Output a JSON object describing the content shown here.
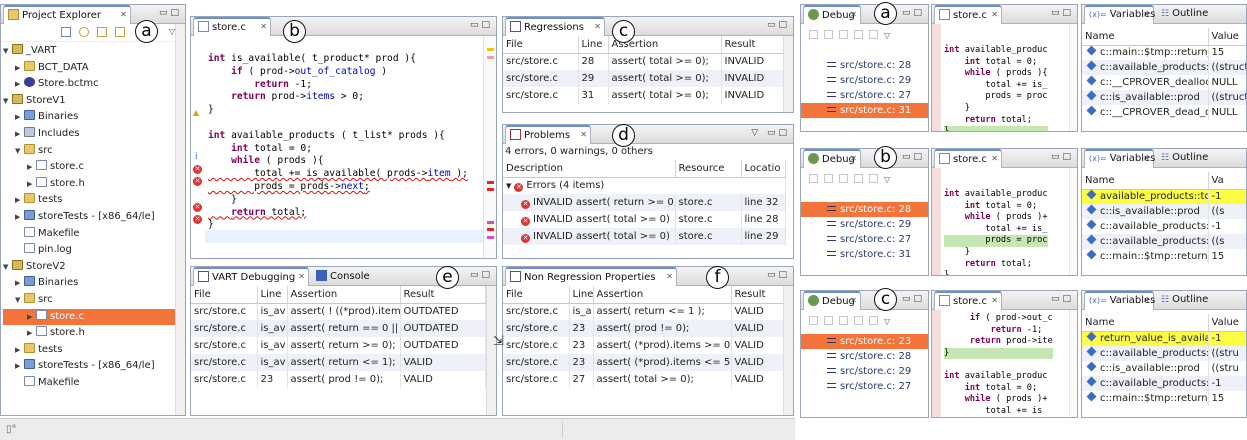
{
  "project_explorer": {
    "title": "Project Explorer",
    "items": [
      {
        "label": "_VART",
        "depth": 0,
        "kind": "proj",
        "expanded": true
      },
      {
        "label": "BCT_DATA",
        "depth": 1,
        "kind": "folder"
      },
      {
        "label": "Store.bctmc",
        "depth": 1,
        "kind": "dot"
      },
      {
        "label": "StoreV1",
        "depth": 0,
        "kind": "proj",
        "expanded": true
      },
      {
        "label": "Binaries",
        "depth": 1,
        "kind": "bin"
      },
      {
        "label": "Includes",
        "depth": 1,
        "kind": "inc"
      },
      {
        "label": "src",
        "depth": 1,
        "kind": "folder",
        "expanded": true
      },
      {
        "label": "store.c",
        "depth": 2,
        "kind": "file"
      },
      {
        "label": "store.h",
        "depth": 2,
        "kind": "file"
      },
      {
        "label": "tests",
        "depth": 1,
        "kind": "folder"
      },
      {
        "label": "storeTests - [x86_64/le]",
        "depth": 1,
        "kind": "bin"
      },
      {
        "label": "Makefile",
        "depth": 1,
        "kind": "file"
      },
      {
        "label": "pin.log",
        "depth": 1,
        "kind": "file"
      },
      {
        "label": "StoreV2",
        "depth": 0,
        "kind": "proj",
        "expanded": true
      },
      {
        "label": "Binaries",
        "depth": 1,
        "kind": "bin"
      },
      {
        "label": "src",
        "depth": 1,
        "kind": "folder",
        "expanded": true
      },
      {
        "label": "store.c",
        "depth": 2,
        "kind": "file",
        "selected": true
      },
      {
        "label": "store.h",
        "depth": 2,
        "kind": "file"
      },
      {
        "label": "tests",
        "depth": 1,
        "kind": "folder"
      },
      {
        "label": "storeTests - [x86_64/le]",
        "depth": 1,
        "kind": "bin"
      },
      {
        "label": "Makefile",
        "depth": 1,
        "kind": "file"
      }
    ]
  },
  "editor": {
    "title": "store.c",
    "lines": [
      "int is_available( t_product* prod ){",
      "    if ( prod->out_of_catalog )",
      "        return -1;",
      "    return prod->items > 0;",
      "}",
      "",
      "int available_products ( t_list* prods ){",
      "    int total = 0;",
      "    while ( prods ){",
      "        total += is_available( prods->item );",
      "        prods = prods->next;",
      "    }",
      "    return total;",
      "}"
    ]
  },
  "regressions": {
    "title": "Regressions",
    "columns": [
      "File",
      "Line",
      "Assertion",
      "Result"
    ],
    "rows": [
      [
        "src/store.c",
        "28",
        "assert( total >= 0);",
        "INVALID"
      ],
      [
        "src/store.c",
        "29",
        "assert( total >= 0);",
        "INVALID"
      ],
      [
        "src/store.c",
        "31",
        "assert( total >= 0);",
        "INVALID"
      ]
    ]
  },
  "problems": {
    "title": "Problems",
    "summary": "4 errors, 0 warnings, 0 others",
    "columns": [
      "Description",
      "Resource",
      "Locatio"
    ],
    "group": "Errors (4 items)",
    "rows": [
      [
        "INVALID assert( return >= 0)",
        "store.c",
        "line 32"
      ],
      [
        "INVALID assert( total >= 0)",
        "store.c",
        "line 28"
      ],
      [
        "INVALID assert( total >= 0)",
        "store.c",
        "line 29"
      ]
    ]
  },
  "vart": {
    "title": "VART Debugging",
    "console_tab": "Console",
    "columns": [
      "File",
      "Line",
      "Assertion",
      "Result"
    ],
    "rows": [
      [
        "src/store.c",
        "is_av",
        "assert( ! ((*prod).item",
        "OUTDATED"
      ],
      [
        "src/store.c",
        "is_av",
        "assert( return == 0 || re",
        "OUTDATED"
      ],
      [
        "src/store.c",
        "is_av",
        "assert( return >= 0);",
        "OUTDATED"
      ],
      [
        "src/store.c",
        "is_av",
        "assert( return <= 1);",
        "VALID"
      ],
      [
        "src/store.c",
        "23",
        "assert( prod != 0);",
        "VALID"
      ]
    ]
  },
  "nonreg": {
    "title": "Non Regression Properties",
    "columns": [
      "File",
      "Line",
      "Assertion",
      "Result"
    ],
    "rows": [
      [
        "src/store.c",
        "is_a",
        "assert( return <= 1 );",
        "VALID"
      ],
      [
        "src/store.c",
        "23",
        "assert( prod != 0);",
        "VALID"
      ],
      [
        "src/store.c",
        "23",
        "assert( (*prod).items >= 0);",
        "VALID"
      ],
      [
        "src/store.c",
        "23",
        "assert( (*prod).items <= 5);",
        "VALID"
      ],
      [
        "src/store.c",
        "27",
        "assert( total >= 0);",
        "VALID"
      ]
    ]
  },
  "callouts": {
    "a": "a",
    "b": "b",
    "c": "c",
    "d": "d",
    "e": "e",
    "f": "f"
  },
  "right_panels": [
    {
      "callout": "a",
      "debug_title": "Debug",
      "editor_title": "store.c",
      "vars_title": "Variables",
      "outline_title": "Outline",
      "var_columns": [
        "Name",
        "Value"
      ],
      "frames": [
        {
          "label": "src/store.c: 28",
          "selected": false
        },
        {
          "label": "src/store.c: 29",
          "selected": false
        },
        {
          "label": "src/store.c: 27",
          "selected": false
        },
        {
          "label": "src/store.c: 31",
          "selected": true
        }
      ],
      "code": [
        "int available_produc",
        "    int total = 0;",
        "    while ( prods ){",
        "        total += is_",
        "        prods = proc",
        "    }",
        "    return total;",
        "}"
      ],
      "vars": [
        {
          "name": "c::main::$tmp::return_",
          "value": "15",
          "hl": false
        },
        {
          "name": "c::available_products:",
          "value": "((struct li",
          "hl": false
        },
        {
          "name": "c::__CPROVER_dealloc",
          "value": "NULL",
          "hl": false
        },
        {
          "name": "c::is_available::prod",
          "value": "((struct p",
          "hl": false
        },
        {
          "name": "c::__CPROVER_dead_c",
          "value": "NULL",
          "hl": false
        }
      ]
    },
    {
      "callout": "b",
      "debug_title": "Debug",
      "editor_title": "store.c",
      "vars_title": "Variables",
      "outline_title": "Outline",
      "var_columns": [
        "Name",
        "Va"
      ],
      "frames": [
        {
          "label": "src/store.c: 28",
          "selected": true
        },
        {
          "label": "src/store.c: 29",
          "selected": false
        },
        {
          "label": "src/store.c: 27",
          "selected": false
        },
        {
          "label": "src/store.c: 31",
          "selected": false
        }
      ],
      "code": [
        "int available_produc",
        "    int total = 0;",
        "    while ( prods )+",
        "        total += is_",
        "        prods = proc",
        "    }",
        "    return total;",
        "}"
      ],
      "vars": [
        {
          "name": "available_products::total",
          "value": "-1",
          "hl": true
        },
        {
          "name": "c::is_available::prod",
          "value": "((s",
          "hl": false
        },
        {
          "name": "c::available_products::$tm",
          "value": "-1",
          "hl": false
        },
        {
          "name": "c::available_products::pro",
          "value": "((s",
          "hl": false
        },
        {
          "name": "c::main::$tmp::return_valu",
          "value": "15",
          "hl": false
        }
      ]
    },
    {
      "callout": "c",
      "debug_title": "Debug",
      "editor_title": "store.c",
      "vars_title": "Variables",
      "outline_title": "Outline",
      "var_columns": [
        "Name",
        "Value"
      ],
      "frames": [
        {
          "label": "src/store.c: 23",
          "selected": true
        },
        {
          "label": "src/store.c: 28",
          "selected": false
        },
        {
          "label": "src/store.c: 29",
          "selected": false
        },
        {
          "label": "src/store.c: 27",
          "selected": false
        }
      ],
      "code": [
        "     if ( prod->out_c",
        "         return -1;",
        "     return prod->ite",
        "}",
        "",
        "int available_produc",
        "    int total = 0;",
        "    while ( prods )+",
        "        total += is"
      ],
      "vars": [
        {
          "name": "return_value_is_availal",
          "value": "-1",
          "hl": true
        },
        {
          "name": "c::available_products:",
          "value": "((stru",
          "hl": false
        },
        {
          "name": "c::is_available::prod",
          "value": "((stru",
          "hl": false
        },
        {
          "name": "c::available_products:",
          "value": "-1",
          "hl": false
        },
        {
          "name": "c::main::$tmp::return_",
          "value": "15",
          "hl": false
        }
      ]
    }
  ]
}
